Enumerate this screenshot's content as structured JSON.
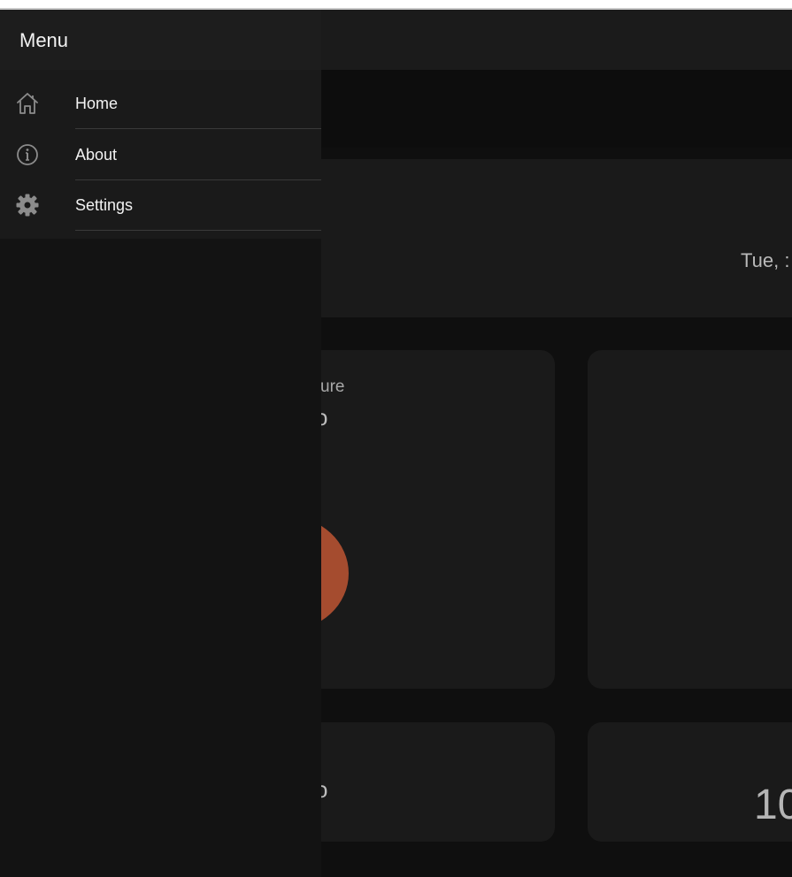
{
  "drawer": {
    "title": "Menu",
    "items": [
      {
        "label": "Home",
        "icon": "home-icon"
      },
      {
        "label": "About",
        "icon": "info-icon"
      },
      {
        "label": "Settings",
        "icon": "gear-icon"
      }
    ]
  },
  "background": {
    "date_text": "Tue, :",
    "card_label_fragment": "ure",
    "temp_fragment": "o",
    "temp_fragment_2": "o",
    "big_number_fragment": "10",
    "gauge_color": "#a54c2f"
  }
}
